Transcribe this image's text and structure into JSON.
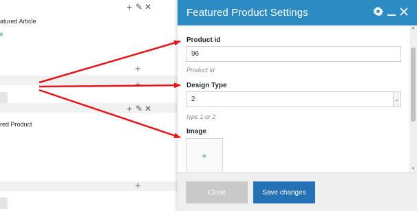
{
  "background": {
    "element1": {
      "title_fragment": "atured Article",
      "link_fragment": "s"
    },
    "element2": {
      "title_fragment": "red Product"
    },
    "toolbar_icons": {
      "add": "+",
      "edit": "✎",
      "remove": "✕"
    },
    "row_add_icon": "+"
  },
  "modal": {
    "title": "Featured Product Settings",
    "header_icons": {
      "settings": "gear-icon",
      "minimize": "minimize-icon",
      "close": "close-icon"
    },
    "fields": {
      "product_id": {
        "label": "Product id",
        "value": "96",
        "help": "Product id"
      },
      "design_type": {
        "label": "Design Type",
        "value": "2",
        "help": "type 1 or 2"
      },
      "image": {
        "label": "Image"
      }
    },
    "footer": {
      "close_label": "Close",
      "save_label": "Save changes"
    }
  },
  "colors": {
    "header_blue": "#2d8bc3",
    "save_button": "#2471b5",
    "close_button": "#c9c9c9",
    "arrow_red": "#e8141a",
    "image_plus": "#3fae49"
  }
}
